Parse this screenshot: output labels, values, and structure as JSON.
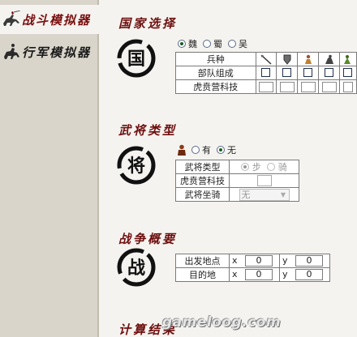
{
  "sidebar": {
    "items": [
      {
        "label": "战斗模拟器",
        "icon": "cavalry-icon"
      },
      {
        "label": "行军模拟器",
        "icon": "horse-rider-icon"
      }
    ]
  },
  "country": {
    "title": "国家选择",
    "emblem_char": "国",
    "options": [
      "魏",
      "蜀",
      "吴"
    ],
    "selected": "魏",
    "table": {
      "header_label": "兵种",
      "unit_icons": [
        "spear-icon",
        "shield-icon",
        "archer-icon",
        "cavalry-unit-icon",
        "siege-icon"
      ],
      "rows": [
        {
          "label": "部队组成",
          "type": "checkbox"
        },
        {
          "label": "虎贲营科技",
          "type": "textbox"
        }
      ]
    }
  },
  "general": {
    "title": "武将类型",
    "emblem_char": "将",
    "has_general": {
      "icon": "general-icon",
      "options": [
        "有",
        "无"
      ],
      "selected": "无"
    },
    "rows": {
      "type_label": "武将类型",
      "type_options": [
        "步",
        "骑"
      ],
      "type_selected": "步",
      "tech_label": "虎贲营科技",
      "mount_label": "武将坐骑",
      "mount_value": "无"
    }
  },
  "battle": {
    "title": "战争概要",
    "emblem_char": "战",
    "rows": [
      {
        "label": "出发地点",
        "x_label": "x",
        "x": "0",
        "y_label": "y",
        "y": "0"
      },
      {
        "label": "目的地",
        "x_label": "x",
        "x": "0",
        "y_label": "y",
        "y": "0"
      }
    ]
  },
  "result": {
    "title": "计算结果"
  },
  "watermark": "gameloog.com"
}
